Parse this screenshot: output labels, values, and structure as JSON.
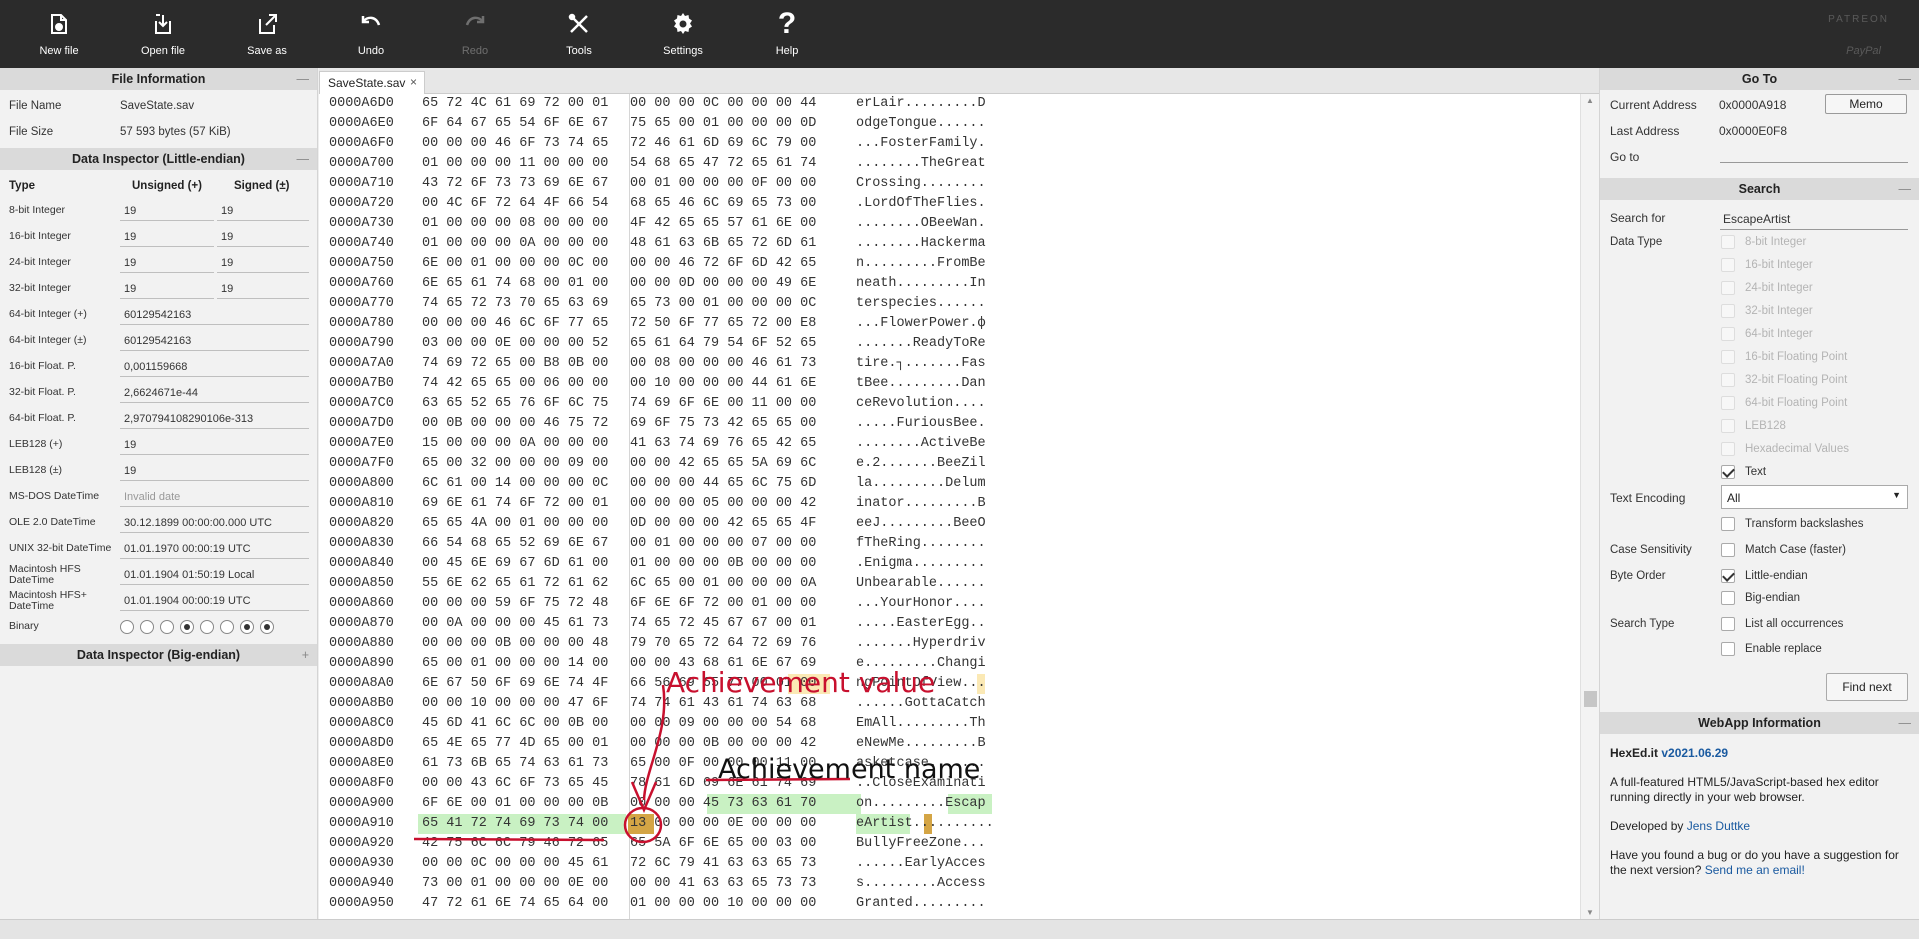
{
  "toolbar": {
    "buttons": [
      {
        "label": "New file",
        "icon": "new-file-icon"
      },
      {
        "label": "Open file",
        "icon": "open-file-icon"
      },
      {
        "label": "Save as",
        "icon": "save-as-icon"
      },
      {
        "label": "Undo",
        "icon": "undo-icon"
      },
      {
        "label": "Redo",
        "icon": "redo-icon",
        "disabled": true
      },
      {
        "label": "Tools",
        "icon": "tools-icon"
      },
      {
        "label": "Settings",
        "icon": "gear-icon"
      },
      {
        "label": "Help",
        "icon": "help-icon"
      }
    ],
    "patreon": "PATREON",
    "paypal": "PayPal"
  },
  "file_info": {
    "title": "File Information",
    "toggle": "—",
    "name_label": "File Name",
    "name_value": "SaveState.sav",
    "size_label": "File Size",
    "size_value": "57 593 bytes (57 KiB)"
  },
  "inspector_le": {
    "title": "Data Inspector (Little-endian)",
    "toggle": "—",
    "col_type": "Type",
    "col_unsigned": "Unsigned (+)",
    "col_signed": "Signed (±)",
    "rows": [
      {
        "type": "8-bit Integer",
        "unsigned": "19",
        "signed": "19"
      },
      {
        "type": "16-bit Integer",
        "unsigned": "19",
        "signed": "19"
      },
      {
        "type": "24-bit Integer",
        "unsigned": "19",
        "signed": "19"
      },
      {
        "type": "32-bit Integer",
        "unsigned": "19",
        "signed": "19"
      },
      {
        "type": "64-bit Integer (+)",
        "value": "60129542163"
      },
      {
        "type": "64-bit Integer (±)",
        "value": "60129542163"
      },
      {
        "type": "16-bit Float. P.",
        "value": "0,001159668"
      },
      {
        "type": "32-bit Float. P.",
        "value": "2,6624671e-44"
      },
      {
        "type": "64-bit Float. P.",
        "value": "2,970794108290106e-313"
      },
      {
        "type": "LEB128 (+)",
        "value": "19"
      },
      {
        "type": "LEB128 (±)",
        "value": "19"
      },
      {
        "type": "MS-DOS DateTime",
        "value": "Invalid date"
      },
      {
        "type": "OLE 2.0 DateTime",
        "value": "30.12.1899 00:00:00.000 UTC"
      },
      {
        "type": "UNIX 32-bit DateTime",
        "value": "01.01.1970 00:00:19 UTC"
      },
      {
        "type": "Macintosh HFS DateTime",
        "value": "01.01.1904 01:50:19 Local"
      },
      {
        "type": "Macintosh HFS+ DateTime",
        "value": "01.01.1904 00:00:19 UTC"
      },
      {
        "type": "Binary",
        "bits": [
          0,
          0,
          0,
          1,
          0,
          0,
          1,
          1
        ]
      }
    ]
  },
  "inspector_be": {
    "title": "Data Inspector (Big-endian)",
    "toggle": "+"
  },
  "tab": {
    "label": "SaveState.sav",
    "close": "×"
  },
  "hex": {
    "rows": [
      {
        "addr": "0000A6D0",
        "b1": "65 72 4C 61 69 72 00 01",
        "b2": "00 00 00 0C 00 00 00 44",
        "ascii": "erLair.........D"
      },
      {
        "addr": "0000A6E0",
        "b1": "6F 64 67 65 54 6F 6E 67",
        "b2": "75 65 00 01 00 00 00 0D",
        "ascii": "odgeTongue......"
      },
      {
        "addr": "0000A6F0",
        "b1": "00 00 00 46 6F 73 74 65",
        "b2": "72 46 61 6D 69 6C 79 00",
        "ascii": "...FosterFamily."
      },
      {
        "addr": "0000A700",
        "b1": "01 00 00 00 11 00 00 00",
        "b2": "54 68 65 47 72 65 61 74",
        "ascii": "........TheGreat"
      },
      {
        "addr": "0000A710",
        "b1": "43 72 6F 73 73 69 6E 67",
        "b2": "00 01 00 00 00 0F 00 00",
        "ascii": "Crossing........"
      },
      {
        "addr": "0000A720",
        "b1": "00 4C 6F 72 64 4F 66 54",
        "b2": "68 65 46 6C 69 65 73 00",
        "ascii": ".LordOfTheFlies."
      },
      {
        "addr": "0000A730",
        "b1": "01 00 00 00 08 00 00 00",
        "b2": "4F 42 65 65 57 61 6E 00",
        "ascii": "........OBeeWan."
      },
      {
        "addr": "0000A740",
        "b1": "01 00 00 00 0A 00 00 00",
        "b2": "48 61 63 6B 65 72 6D 61",
        "ascii": "........Hackerma"
      },
      {
        "addr": "0000A750",
        "b1": "6E 00 01 00 00 00 0C 00",
        "b2": "00 00 46 72 6F 6D 42 65",
        "ascii": "n.........FromBe"
      },
      {
        "addr": "0000A760",
        "b1": "6E 65 61 74 68 00 01 00",
        "b2": "00 00 0D 00 00 00 49 6E",
        "ascii": "neath.........In"
      },
      {
        "addr": "0000A770",
        "b1": "74 65 72 73 70 65 63 69",
        "b2": "65 73 00 01 00 00 00 0C",
        "ascii": "terspecies......"
      },
      {
        "addr": "0000A780",
        "b1": "00 00 00 46 6C 6F 77 65",
        "b2": "72 50 6F 77 65 72 00 E8",
        "ascii": "...FlowerPower.ф"
      },
      {
        "addr": "0000A790",
        "b1": "03 00 00 0E 00 00 00 52",
        "b2": "65 61 64 79 54 6F 52 65",
        "ascii": ".......ReadyToRe"
      },
      {
        "addr": "0000A7A0",
        "b1": "74 69 72 65 00 B8 0B 00",
        "b2": "00 08 00 00 00 46 61 73",
        "ascii": "tire.┐.......Fas"
      },
      {
        "addr": "0000A7B0",
        "b1": "74 42 65 65 00 06 00 00",
        "b2": "00 10 00 00 00 44 61 6E",
        "ascii": "tBee.........Dan"
      },
      {
        "addr": "0000A7C0",
        "b1": "63 65 52 65 76 6F 6C 75",
        "b2": "74 69 6F 6E 00 11 00 00",
        "ascii": "ceRevolution...."
      },
      {
        "addr": "0000A7D0",
        "b1": "00 0B 00 00 00 46 75 72",
        "b2": "69 6F 75 73 42 65 65 00",
        "ascii": ".....FuriousBee."
      },
      {
        "addr": "0000A7E0",
        "b1": "15 00 00 00 0A 00 00 00",
        "b2": "41 63 74 69 76 65 42 65",
        "ascii": "........ActiveBe"
      },
      {
        "addr": "0000A7F0",
        "b1": "65 00 32 00 00 00 09 00",
        "b2": "00 00 42 65 65 5A 69 6C",
        "ascii": "e.2.......BeeZil"
      },
      {
        "addr": "0000A800",
        "b1": "6C 61 00 14 00 00 00 0C",
        "b2": "00 00 00 44 65 6C 75 6D",
        "ascii": "la.........Delum"
      },
      {
        "addr": "0000A810",
        "b1": "69 6E 61 74 6F 72 00 01",
        "b2": "00 00 00 05 00 00 00 42",
        "ascii": "inator.........B"
      },
      {
        "addr": "0000A820",
        "b1": "65 65 4A 00 01 00 00 00",
        "b2": "0D 00 00 00 42 65 65 4F",
        "ascii": "eeJ.........BeeO"
      },
      {
        "addr": "0000A830",
        "b1": "66 54 68 65 52 69 6E 67",
        "b2": "00 01 00 00 00 07 00 00",
        "ascii": "fTheRing........"
      },
      {
        "addr": "0000A840",
        "b1": "00 45 6E 69 67 6D 61 00",
        "b2": "01 00 00 00 0B 00 00 00",
        "ascii": ".Enigma........."
      },
      {
        "addr": "0000A850",
        "b1": "55 6E 62 65 61 72 61 62",
        "b2": "6C 65 00 01 00 00 00 0A",
        "ascii": "Unbearable......"
      },
      {
        "addr": "0000A860",
        "b1": "00 00 00 59 6F 75 72 48",
        "b2": "6F 6E 6F 72 00 01 00 00",
        "ascii": "...YourHonor...."
      },
      {
        "addr": "0000A870",
        "b1": "00 0A 00 00 00 45 61 73",
        "b2": "74 65 72 45 67 67 00 01",
        "ascii": ".....EasterEgg.."
      },
      {
        "addr": "0000A880",
        "b1": "00 00 00 0B 00 00 00 48",
        "b2": "79 70 65 72 64 72 69 76",
        "ascii": ".......Hyperdriv"
      },
      {
        "addr": "0000A890",
        "b1": "65 00 01 00 00 00 14 00",
        "b2": "00 00 43 68 61 6E 67 69",
        "ascii": "e.........Changi"
      },
      {
        "addr": "0000A8A0",
        "b1": "6E 67 50 6F 69 6E 74 4F",
        "b2": "66 56 69 65 77 00 01 00",
        "ascii": "ngPointOfView..."
      },
      {
        "addr": "0000A8B0",
        "b1": "00 00 10 00 00 00 47 6F",
        "b2": "74 74 61 43 61 74 63 68",
        "ascii": "......GottaCatch"
      },
      {
        "addr": "0000A8C0",
        "b1": "45 6D 41 6C 6C 00 0B 00",
        "b2": "00 00 09 00 00 00 54 68",
        "ascii": "EmAll.........Th"
      },
      {
        "addr": "0000A8D0",
        "b1": "65 4E 65 77 4D 65 00 01",
        "b2": "00 00 00 0B 00 00 00 42",
        "ascii": "eNewMe.........B"
      },
      {
        "addr": "0000A8E0",
        "b1": "61 73 6B 65 74 63 61 73",
        "b2": "65 00 0F 00 00 00 11 00",
        "ascii": "asketcase......."
      },
      {
        "addr": "0000A8F0",
        "b1": "00 00 43 6C 6F 73 65 45",
        "b2": "78 61 6D 69 6E 61 74 69",
        "ascii": "..CloseExaminati"
      },
      {
        "addr": "0000A900",
        "b1": "6F 6E 00 01 00 00 00 0B",
        "b2": "00 00 00 45 73 63 61 70",
        "ascii": "on.........Escap"
      },
      {
        "addr": "0000A910",
        "b1": "65 41 72 74 69 73 74 00",
        "b2": "13 00 00 00 0E 00 00 00",
        "ascii": "eArtist.........."
      },
      {
        "addr": "0000A920",
        "b1": "42 75 6C 6C 79 46 72 65",
        "b2": "65 5A 6F 6E 65 00 03 00",
        "ascii": "BullyFreeZone..."
      },
      {
        "addr": "0000A930",
        "b1": "00 00 0C 00 00 00 45 61",
        "b2": "72 6C 79 41 63 63 65 73",
        "ascii": "......EarlyAcces"
      },
      {
        "addr": "0000A940",
        "b1": "73 00 01 00 00 00 0E 00",
        "b2": "00 00 41 63 63 65 73 73",
        "ascii": "s.........Access"
      },
      {
        "addr": "0000A950",
        "b1": "47 72 61 6E 74 65 64 00",
        "b2": "01 00 00 00 10 00 00 00",
        "ascii": "Granted........."
      }
    ]
  },
  "annotations": {
    "value": "Achievement value",
    "name": "Achievement name"
  },
  "goto": {
    "title": "Go To",
    "toggle": "—",
    "current_label": "Current Address",
    "current_value": "0x0000A918",
    "memo": "Memo",
    "last_label": "Last Address",
    "last_value": "0x0000E0F8",
    "goto_label": "Go to"
  },
  "search": {
    "title": "Search",
    "toggle": "—",
    "search_for_label": "Search for",
    "search_for_value": "EscapeArtist",
    "data_type_label": "Data Type",
    "data_types": [
      {
        "label": "8-bit Integer",
        "checked": false,
        "disabled": true
      },
      {
        "label": "16-bit Integer",
        "checked": false,
        "disabled": true
      },
      {
        "label": "24-bit Integer",
        "checked": false,
        "disabled": true
      },
      {
        "label": "32-bit Integer",
        "checked": false,
        "disabled": true
      },
      {
        "label": "64-bit Integer",
        "checked": false,
        "disabled": true
      },
      {
        "label": "16-bit Floating Point",
        "checked": false,
        "disabled": true
      },
      {
        "label": "32-bit Floating Point",
        "checked": false,
        "disabled": true
      },
      {
        "label": "64-bit Floating Point",
        "checked": false,
        "disabled": true
      },
      {
        "label": "LEB128",
        "checked": false,
        "disabled": true
      },
      {
        "label": "Hexadecimal Values",
        "checked": false,
        "disabled": true
      },
      {
        "label": "Text",
        "checked": true,
        "disabled": false
      }
    ],
    "encoding_label": "Text Encoding",
    "encoding_value": "All",
    "transform_label": "Transform backslashes",
    "case_label": "Case Sensitivity",
    "match_case_label": "Match Case (faster)",
    "byte_order_label": "Byte Order",
    "little_label": "Little-endian",
    "big_label": "Big-endian",
    "search_type_label": "Search Type",
    "list_all_label": "List all occurrences",
    "replace_label": "Enable replace",
    "find_next": "Find next"
  },
  "webapp": {
    "title": "WebApp Information",
    "toggle": "—",
    "name": "HexEd.it",
    "version": "v2021.06.29",
    "desc": "A full-featured HTML5/JavaScript-based hex editor running directly in your web browser.",
    "dev_prefix": "Developed by ",
    "dev_name": "Jens Duttke",
    "bug_text": "Have you found a bug or do you have a suggestion for the next version? ",
    "bug_link": "Send me an email!"
  },
  "colors": {
    "highlight_green": "#c9f1c3",
    "highlight_gold": "#d4a545",
    "annotation_red": "#c8102e",
    "toolbar_bg": "#2b2b2b"
  }
}
